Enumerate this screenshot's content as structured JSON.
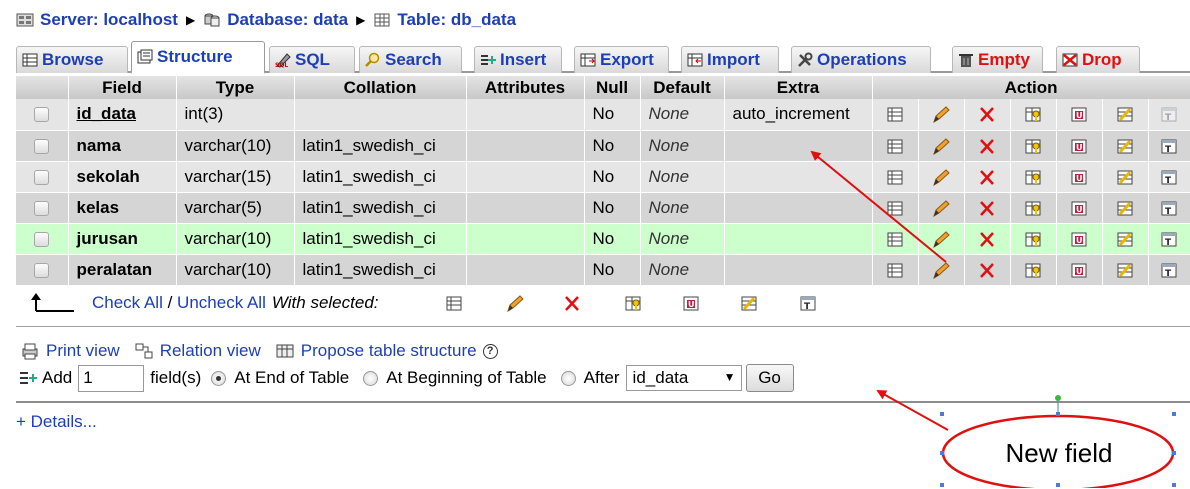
{
  "breadcrumb": {
    "server": "Server: localhost",
    "database": "Database: data",
    "table": "Table: db_data"
  },
  "tabs": [
    {
      "label": "Browse",
      "icon": "browse-icon"
    },
    {
      "label": "Structure",
      "icon": "structure-icon",
      "active": true
    },
    {
      "label": "SQL",
      "icon": "sql-icon"
    },
    {
      "label": "Search",
      "icon": "search-icon"
    },
    {
      "label": "Insert",
      "icon": "insert-icon"
    },
    {
      "label": "Export",
      "icon": "export-icon"
    },
    {
      "label": "Import",
      "icon": "import-icon"
    },
    {
      "label": "Operations",
      "icon": "operations-icon"
    },
    {
      "label": "Empty",
      "icon": "empty-icon",
      "danger": true
    },
    {
      "label": "Drop",
      "icon": "drop-icon",
      "danger": true
    }
  ],
  "table": {
    "headers": [
      "Field",
      "Type",
      "Collation",
      "Attributes",
      "Null",
      "Default",
      "Extra",
      "Action"
    ],
    "rows": [
      {
        "field": "id_data",
        "type": "int(3)",
        "collation": "",
        "attributes": "",
        "null": "No",
        "default": "None",
        "extra": "auto_increment"
      },
      {
        "field": "nama",
        "type": "varchar(10)",
        "collation": "latin1_swedish_ci",
        "attributes": "",
        "null": "No",
        "default": "None",
        "extra": ""
      },
      {
        "field": "sekolah",
        "type": "varchar(15)",
        "collation": "latin1_swedish_ci",
        "attributes": "",
        "null": "No",
        "default": "None",
        "extra": ""
      },
      {
        "field": "kelas",
        "type": "varchar(5)",
        "collation": "latin1_swedish_ci",
        "attributes": "",
        "null": "No",
        "default": "None",
        "extra": ""
      },
      {
        "field": "jurusan",
        "type": "varchar(10)",
        "collation": "latin1_swedish_ci",
        "attributes": "",
        "null": "No",
        "default": "None",
        "extra": ""
      },
      {
        "field": "peralatan",
        "type": "varchar(10)",
        "collation": "latin1_swedish_ci",
        "attributes": "",
        "null": "No",
        "default": "None",
        "extra": ""
      }
    ],
    "action_icons": [
      "browse-distinct-icon",
      "edit-pencil-icon",
      "delete-x-icon",
      "primary-key-icon",
      "unique-icon",
      "index-icon",
      "fulltext-icon"
    ]
  },
  "bulk": {
    "check_all": "Check All",
    "slash": " / ",
    "uncheck_all": "Uncheck All",
    "with_selected": "With selected:"
  },
  "links": {
    "print_view": "Print view",
    "relation_view": "Relation view",
    "propose": "Propose table structure",
    "help": "?"
  },
  "add_field": {
    "add_label": "Add",
    "count_value": "1",
    "fields_label": "field(s)",
    "at_end": "At End of Table",
    "at_beginning": "At Beginning of Table",
    "after": "After",
    "after_selected": "id_data",
    "go": "Go",
    "selected_position": "at_end"
  },
  "details": "+ Details...",
  "annotation": {
    "callout_text": "New field",
    "color": "#e01010"
  },
  "colors": {
    "link": "#1c3fb7",
    "row_odd": "#e5e5e5",
    "row_even": "#d5d5d5",
    "row_highlight": "#ccffcc"
  }
}
